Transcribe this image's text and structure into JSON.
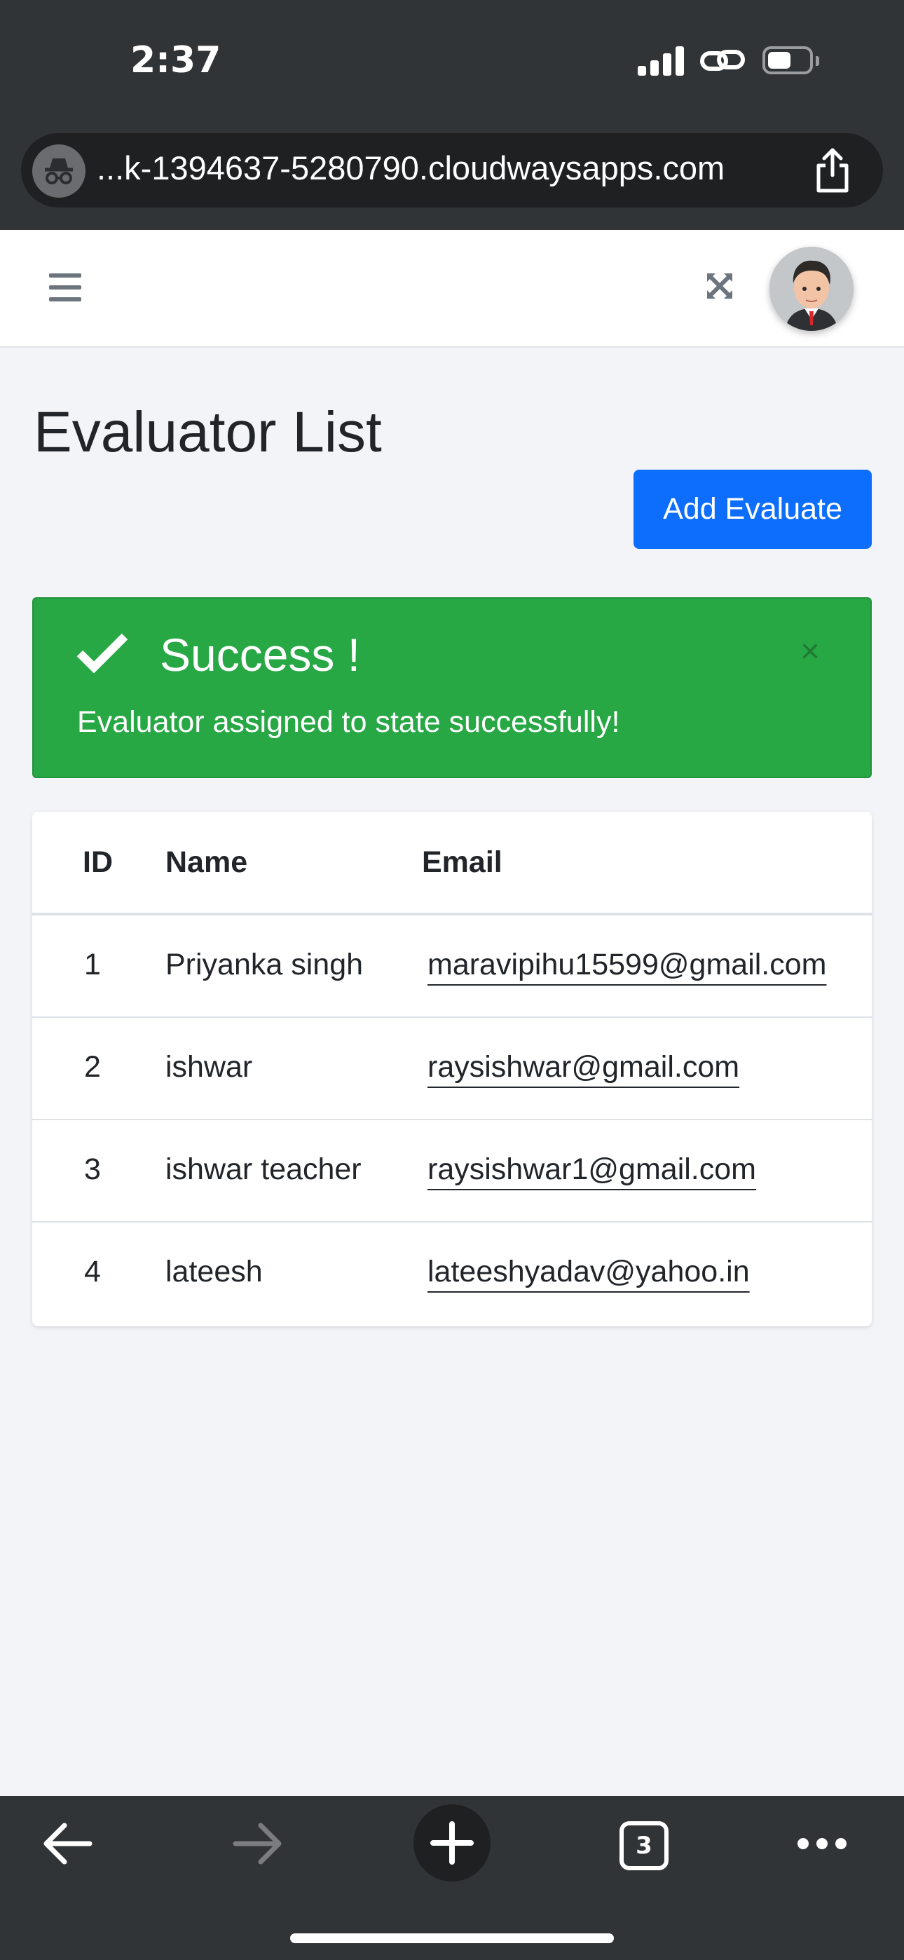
{
  "status_bar": {
    "time": "2:37"
  },
  "browser": {
    "url": "...k-1394637-5280790.cloudwaysapps.com",
    "tab_count": "3"
  },
  "page": {
    "title": "Evaluator List",
    "add_button_label": "Add Evaluate"
  },
  "alert": {
    "title": "Success !",
    "message": "Evaluator assigned to state successfully!",
    "close_symbol": "×",
    "color": "#28a745"
  },
  "table": {
    "headers": {
      "id": "ID",
      "name": "Name",
      "email": "Email"
    },
    "rows": [
      {
        "id": "1",
        "name": "Priyanka singh",
        "email": "maravipihu15599@gmail.com"
      },
      {
        "id": "2",
        "name": "ishwar",
        "email": "raysishwar@gmail.com"
      },
      {
        "id": "3",
        "name": "ishwar teacher",
        "email": "raysishwar1@gmail.com"
      },
      {
        "id": "4",
        "name": "lateesh",
        "email": "lateeshyadav@yahoo.in"
      }
    ]
  },
  "colors": {
    "primary": "#0d6efd",
    "chrome": "#313437",
    "background": "#f3f4f8"
  },
  "icons": [
    "signal-icon",
    "link-icon",
    "battery-icon",
    "incognito-icon",
    "share-icon",
    "hamburger-icon",
    "fullscreen-icon",
    "avatar",
    "check-icon",
    "back-icon",
    "forward-icon",
    "plus-icon",
    "tabs-icon",
    "more-icon"
  ]
}
